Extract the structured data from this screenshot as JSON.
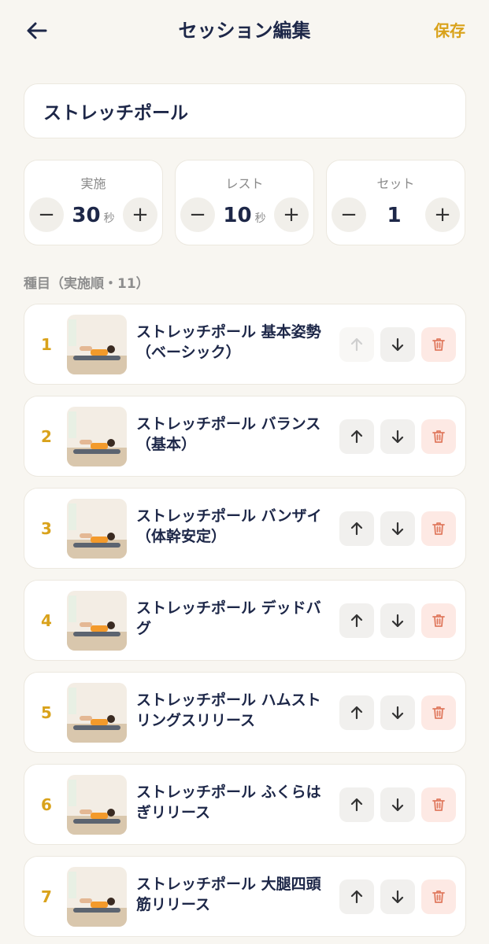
{
  "header": {
    "title": "セッション編集",
    "save_label": "保存"
  },
  "session": {
    "name": "ストレッチポール"
  },
  "stats": [
    {
      "label": "実施",
      "value": "30",
      "unit": "秒"
    },
    {
      "label": "レスト",
      "value": "10",
      "unit": "秒"
    },
    {
      "label": "セット",
      "value": "1",
      "unit": ""
    }
  ],
  "list": {
    "section_label": "種目（実施順・11）",
    "items": [
      {
        "index": "1",
        "title": "ストレッチポール 基本姿勢（ベーシック）",
        "up_disabled": true
      },
      {
        "index": "2",
        "title": "ストレッチポール バランス（基本）",
        "up_disabled": false
      },
      {
        "index": "3",
        "title": "ストレッチポール バンザイ（体幹安定）",
        "up_disabled": false
      },
      {
        "index": "4",
        "title": "ストレッチポール デッドバグ",
        "up_disabled": false
      },
      {
        "index": "5",
        "title": "ストレッチポール ハムストリングスリリース",
        "up_disabled": false
      },
      {
        "index": "6",
        "title": "ストレッチポール ふくらはぎリリース",
        "up_disabled": false
      },
      {
        "index": "7",
        "title": "ストレッチポール 大腿四頭筋リリース",
        "up_disabled": false
      }
    ]
  },
  "colors": {
    "accent": "#d9a21b",
    "title": "#1d2748",
    "delete": "#e07a5f",
    "background": "#f8f6f1"
  },
  "icons": {
    "back": "arrow-left-icon",
    "up": "arrow-up-icon",
    "down": "arrow-down-icon",
    "delete": "trash-icon",
    "minus": "minus-icon",
    "plus": "plus-icon"
  }
}
